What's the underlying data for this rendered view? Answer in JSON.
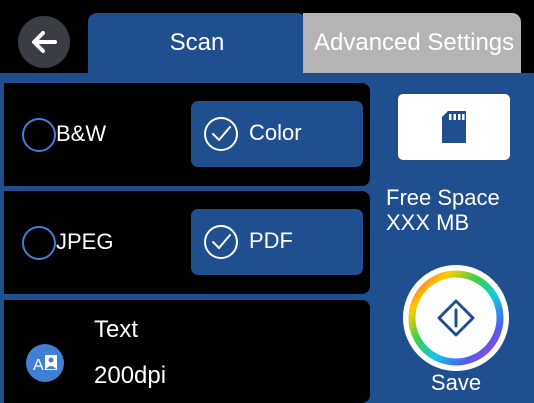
{
  "header": {
    "tabs": [
      {
        "label": "Scan",
        "active": true
      },
      {
        "label": "Advanced Settings",
        "active": false
      }
    ]
  },
  "options": {
    "color_mode": {
      "bw_label": "B&W",
      "color_label": "Color",
      "selected": "Color"
    },
    "file_format": {
      "jpeg_label": "JPEG",
      "pdf_label": "PDF",
      "selected": "PDF"
    },
    "document": {
      "type_label": "Text",
      "resolution_label": "200dpi"
    }
  },
  "storage": {
    "free_space_label": "Free Space",
    "free_space_value": "XXX MB",
    "icon": "memory-card-icon"
  },
  "save": {
    "label": "Save",
    "icon": "start-diamond-icon"
  },
  "colors": {
    "accent_blue": "#1f4f8f",
    "radio_blue": "#3f7fd4",
    "inactive_tab": "#b4b4b4",
    "background": "#000000"
  }
}
